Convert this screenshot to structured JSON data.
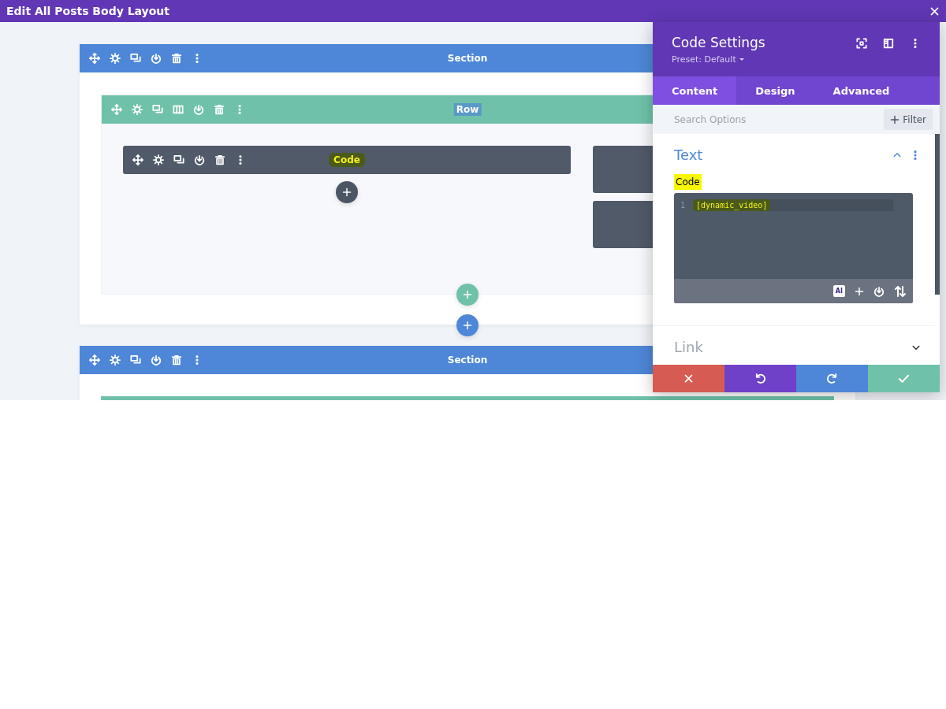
{
  "window": {
    "title": "Edit All Posts Body Layout"
  },
  "canvas": {
    "sections": [
      {
        "label": "Section",
        "rows": [
          {
            "kind": "full",
            "label": "Row",
            "highlighted": true,
            "columns": [
              {
                "modules": [
                  {
                    "kind": "labeled",
                    "label": "Code",
                    "highlighted": true
                  }
                ]
              },
              {
                "modules": [
                  {
                    "kind": "covered"
                  },
                  {
                    "kind": "covered"
                  }
                ]
              }
            ]
          }
        ]
      },
      {
        "label": "Section",
        "rows": [
          {
            "kind": "clipped"
          }
        ]
      }
    ]
  },
  "panel": {
    "title": "Code Settings",
    "preset": "Preset: Default",
    "tabs": [
      {
        "label": "Content",
        "selected": true
      },
      {
        "label": "Design",
        "selected": false
      },
      {
        "label": "Advanced",
        "selected": false
      }
    ],
    "search": {
      "placeholder": "Search Options"
    },
    "filter_button": "Filter",
    "groups": [
      {
        "title": "Text",
        "expanded": true,
        "field_label": "Code",
        "field_highlighted": true,
        "code_lines": [
          {
            "number": "1",
            "text": "[dynamic_video]",
            "highlighted": true
          }
        ],
        "ai_badge": "AI"
      },
      {
        "title": "Link",
        "expanded": false
      }
    ]
  }
}
